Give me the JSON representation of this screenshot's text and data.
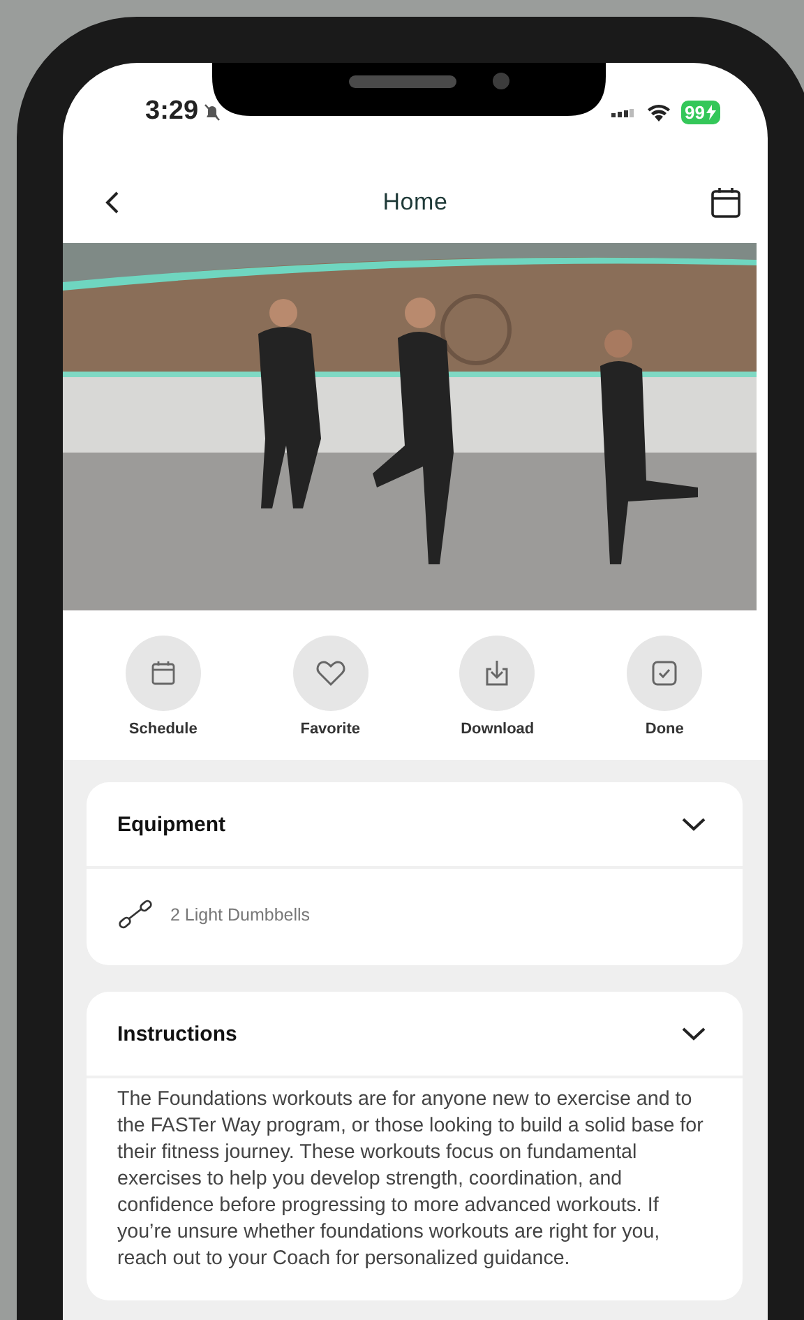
{
  "status_bar": {
    "time": "3:29",
    "battery": "99"
  },
  "nav": {
    "title": "Home"
  },
  "actions": [
    {
      "label": "Schedule",
      "kind": "calendar"
    },
    {
      "label": "Favorite",
      "kind": "heart"
    },
    {
      "label": "Download",
      "kind": "download"
    },
    {
      "label": "Done",
      "kind": "check"
    }
  ],
  "sections": [
    {
      "title": "Equipment",
      "kind": "list",
      "items": [
        {
          "text": "2 Light Dumbbells"
        }
      ]
    },
    {
      "title": "Instructions",
      "kind": "text",
      "text": "The Foundations workouts are for anyone new to exercise and to the FASTer Way program, or those looking to build a solid base for their fitness journey. These workouts focus on fundamental exercises to help you develop strength, coordination, and confidence before progressing to more advanced workouts. If you’re unsure whether foundations workouts are right for you, reach out to your Coach for personalized guidance."
    }
  ]
}
